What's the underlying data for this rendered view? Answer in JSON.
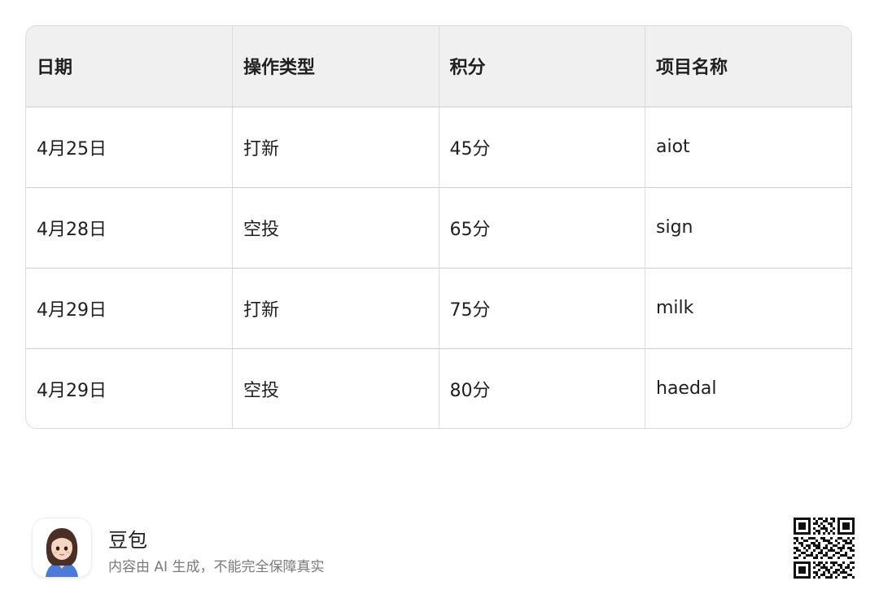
{
  "table": {
    "headers": [
      "日期",
      "操作类型",
      "积分",
      "项目名称"
    ],
    "rows": [
      [
        "4月25日",
        "打新",
        "45分",
        "aiot"
      ],
      [
        "4月28日",
        "空投",
        "65分",
        "sign"
      ],
      [
        "4月29日",
        "打新",
        "75分",
        "milk"
      ],
      [
        "4月29日",
        "空投",
        "80分",
        "haedal"
      ]
    ]
  },
  "footer": {
    "brand_name": "豆包",
    "disclaimer": "内容由 AI 生成，不能完全保障真实",
    "avatar_icon": "assistant-avatar-icon",
    "qr_icon": "qr-code-icon"
  }
}
